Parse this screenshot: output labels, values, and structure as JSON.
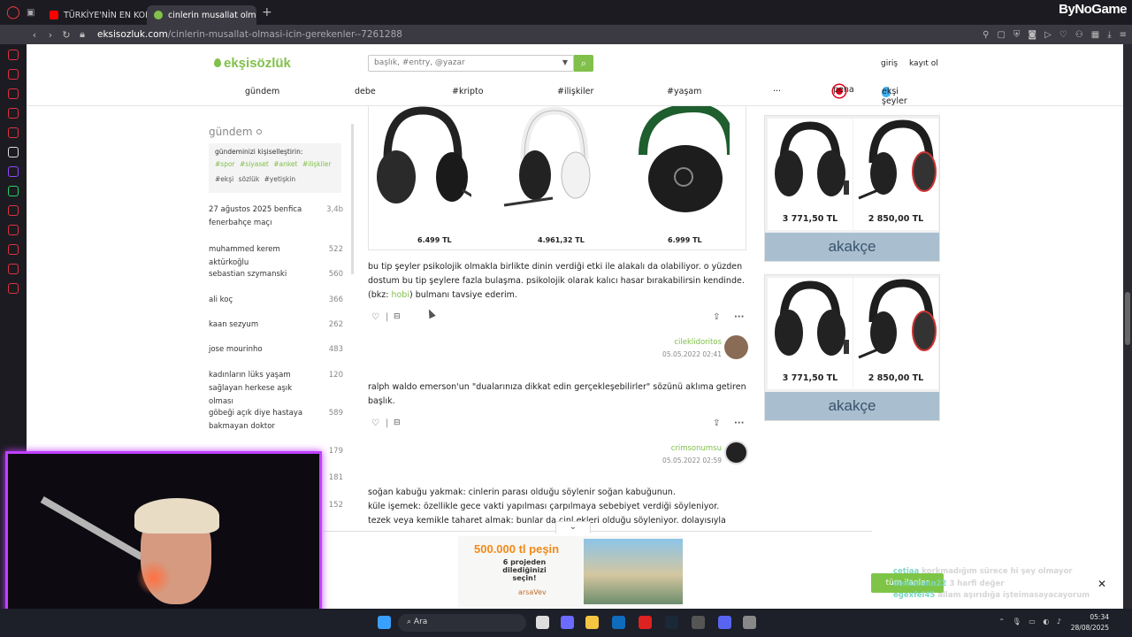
{
  "browser": {
    "tabs": [
      {
        "label": "TÜRKİYE'NİN EN KORKUN",
        "active": false,
        "color": "#ff0000"
      },
      {
        "label": "cinlerin musallat olması iç",
        "active": true,
        "color": "#81c14b"
      }
    ],
    "brand": "ByNoGame",
    "url_domain": "eksisozluk.com",
    "url_path": "/cinlerin-musallat-olmasi-icin-gerekenler--7261288"
  },
  "header": {
    "logo": "ekşisözlük",
    "search_placeholder": "başlık, #entry, @yazar",
    "login": "giriş",
    "register": "kayıt ol",
    "nav": [
      "gündem",
      "debe",
      "#kripto",
      "#ilişkiler",
      "#yaşam",
      "···",
      "pena",
      "ekşi şeyler"
    ]
  },
  "left": {
    "title": "gündem",
    "personalize": "gündeminizi kişiselleştirin:",
    "tags": [
      "#spor",
      "#siyaset",
      "#anket",
      "#ilişkiler"
    ],
    "tags2": [
      "#ekşi sözlük",
      "#yetişkin"
    ],
    "items": [
      {
        "text": "27 ağustos 2025 benfica fenerbahçe maçı",
        "count": "3,4b"
      },
      {
        "text": "muhammed kerem aktürkoğlu",
        "count": "522"
      },
      {
        "text": "sebastian szymanski",
        "count": "560"
      },
      {
        "text": "ali koç",
        "count": "366"
      },
      {
        "text": "kaan sezyum",
        "count": "262"
      },
      {
        "text": "jose mourinho",
        "count": "483"
      },
      {
        "text": "kadınların lüks yaşam sağlayan herkese aşık olması",
        "count": "120"
      },
      {
        "text": "göbeği açık diye hastaya bakmayan doktor",
        "count": "589"
      },
      {
        "text": "",
        "count": "179"
      },
      {
        "text": "",
        "count": "181"
      },
      {
        "text": "",
        "count": "152"
      }
    ]
  },
  "product_prices": [
    "6.499 TL",
    "4.961,32 TL",
    "6.999 TL"
  ],
  "entries": [
    {
      "text_before": "bu tip şeyler psikolojik olmakla birlikte dinin verdiği etki ile alakalı da olabiliyor. o yüzden dostum bu tip şeylere fazla bulaşma. psikolojik olarak kalıcı hasar bırakabilirsin kendinde. (bkz: ",
      "link": "hobi",
      "text_after": ") bulmanı tavsiye ederim.",
      "author": "cileklidoritos",
      "date": "05.05.2022 02:41"
    },
    {
      "text": "ralph waldo emerson'un \"dualarınıza dikkat edin gerçekleşebilirler\" sözünü aklıma getiren başlık.",
      "author": "crimsonumsu",
      "date": "05.05.2022 02:59"
    },
    {
      "lines": [
        "soğan kabuğu yakmak: cinlerin parası olduğu söylenir soğan kabuğunun.",
        "küle işemek: özellikle gece vakti yapılması çarpılmaya sebebiyet verdiği söyleniyor.",
        "tezek veya kemikle taharet almak: bunlar da cinl            ekleri olduğu söyleniyor. dolayısıyla"
      ]
    }
  ],
  "ads": {
    "prices": [
      "3 771,50 TL",
      "2 850,00 TL"
    ],
    "brand": "akakçe"
  },
  "bottom_ad": {
    "promo": "500.000 tl peşin",
    "promo2": "6 projeden dilediğinizi seçin!",
    "brand": "arsaVev",
    "chat_button": "tüm ilanlar"
  },
  "taskbar": {
    "search": "Ara",
    "time": "05:34",
    "date": "28/08/2025"
  },
  "chat": [
    {
      "user": "cetiaa",
      "msg": "korkmadığım sürece hi şey olmayor",
      "bright": false
    },
    {
      "user": "denizcann22",
      "msg": "3 harfi değer",
      "bright": false
    },
    {
      "user": "egexfel45",
      "msg": "allam aşırıdığa işteimasayacayorum",
      "bright": false
    },
    {
      "user": "denizcann22",
      "msg": "o 3 harf değil",
      "bright": true
    },
    {
      "user": "cetiaa",
      "msg": "",
      "bright": true
    }
  ],
  "colors": {
    "brand_green": "#81c14b",
    "webcam_frame": "#c040ff",
    "pena_red": "#e2001a"
  }
}
